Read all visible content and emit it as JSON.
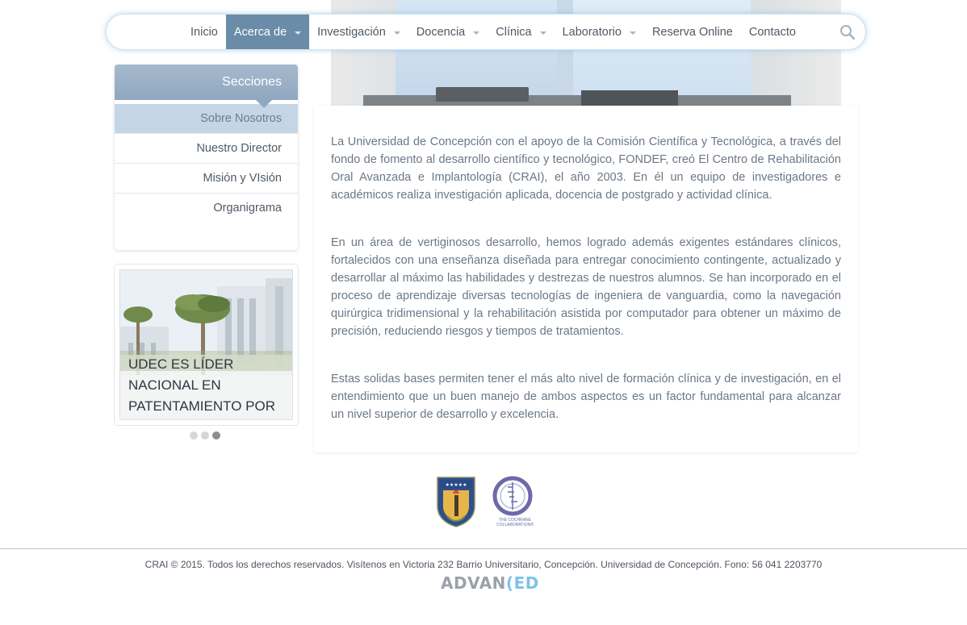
{
  "nav": {
    "items": [
      {
        "label": "Inicio",
        "dropdown": false,
        "active": false
      },
      {
        "label": "Acerca de",
        "dropdown": true,
        "active": true
      },
      {
        "label": "Investigación",
        "dropdown": true,
        "active": false
      },
      {
        "label": "Docencia",
        "dropdown": true,
        "active": false
      },
      {
        "label": "Clínica",
        "dropdown": true,
        "active": false
      },
      {
        "label": "Laboratorio",
        "dropdown": true,
        "active": false
      },
      {
        "label": "Reserva Online",
        "dropdown": false,
        "active": false
      },
      {
        "label": "Contacto",
        "dropdown": false,
        "active": false
      }
    ],
    "search_icon": "search-icon"
  },
  "sidebar": {
    "header": "Secciones",
    "items": [
      {
        "label": "Sobre Nosotros",
        "active": true
      },
      {
        "label": "Nuestro Director",
        "active": false
      },
      {
        "label": "Misión y VIsión",
        "active": false
      },
      {
        "label": "Organigrama",
        "active": false
      }
    ],
    "news": {
      "title_line1": "UDEC ES LÍDER",
      "title_line2": "NACIONAL EN",
      "title_line3": "PATENTAMIENTO POR",
      "slides": 3,
      "active_slide": 3
    }
  },
  "content": {
    "paragraphs": [
      "La Universidad de Concepción con el apoyo de la Comisión Científica y Tecnológica, a través del fondo de fomento al desarrollo científico y tecnológico, FONDEF, creó El Centro de Rehabilitación Oral Avanzada e Implantología (CRAI), el año 2003. En él un equipo de investigadores e académicos realiza investigación aplicada, docencia de postgrado y actividad clínica.",
      "En un área de vertiginosos desarrollo, hemos logrado además exigentes estándares clínicos, fortalecidos con una enseñanza diseñada para entregar conocimiento contingente, actualizado y desarrollar al máximo las habilidades y destrezas de nuestros alumnos. Se han incorporado en el proceso de aprendizaje diversas tecnologías de ingeniera de vanguardia, como la navegación quirúrgica tridimensional y la rehabilitación asistida por computador para obtener un máximo de precisión, reduciendo riesgos y tiempos de tratamientos.",
      "Estas solidas bases permiten tener el más alto nivel de formación clínica y de investigación, en el entendimiento que un buen manejo de ambos aspectos es un factor fundamental para alcanzar un nivel superior de desarrollo y excelencia."
    ]
  },
  "logos": {
    "cochrane_line1": "THE COCHRANE",
    "cochrane_line2": "COLLABORATION®"
  },
  "footer": {
    "text": "CRAI © 2015. Todos los derechos reservados. Visítenos en Victoria 232 Barrio Universitario, Concepción. Universidad de Concepción. Fono: 56 041 2203770",
    "brand_pre": "ADVAN",
    "brand_c": "(",
    "brand_post": "ED"
  }
}
